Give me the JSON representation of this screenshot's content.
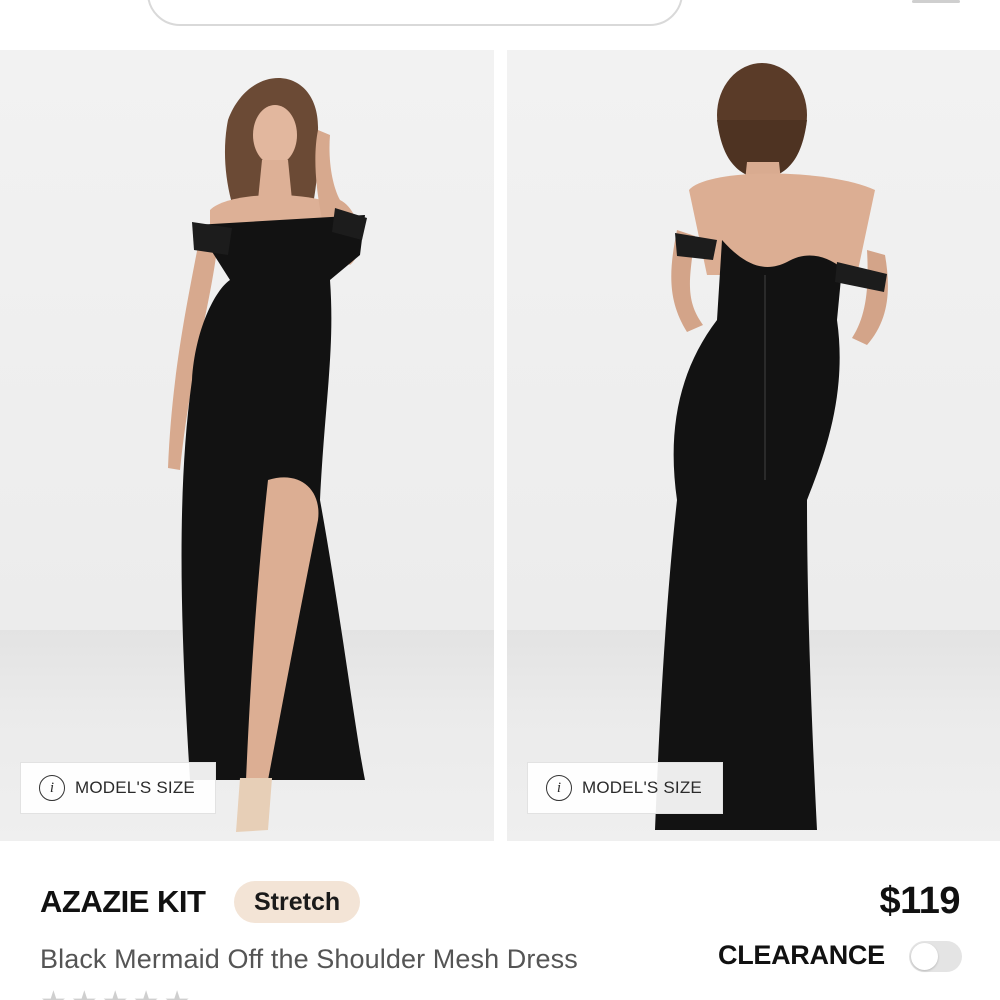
{
  "header": {
    "search_placeholder": ""
  },
  "gallery": {
    "images": [
      {
        "alt": "front view",
        "badge_label": "MODEL'S SIZE"
      },
      {
        "alt": "back view",
        "badge_label": "MODEL'S SIZE"
      }
    ],
    "info_glyph": "i"
  },
  "product": {
    "brand": "AZAZIE KIT",
    "badge": "Stretch",
    "name": "Black Mermaid Off the Shoulder Mesh Dress",
    "price": "$119",
    "clearance_label": "CLEARANCE",
    "clearance_enabled": false,
    "rating_stars": "★★★★★"
  },
  "colors": {
    "badge_bg": "#f3e4d6",
    "dress": "#121212",
    "toggle_off": "#e4e4e4"
  }
}
